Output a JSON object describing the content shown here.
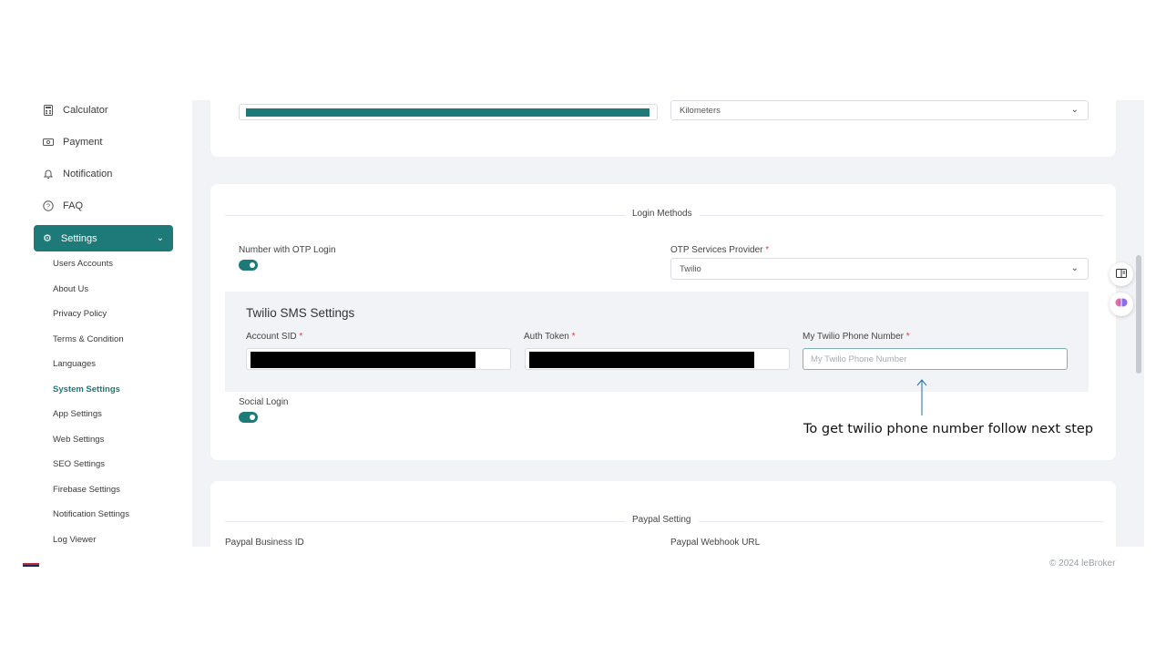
{
  "sidebar": {
    "items": [
      {
        "label": "Calculator",
        "icon": "calculator-icon"
      },
      {
        "label": "Payment",
        "icon": "payment-icon"
      },
      {
        "label": "Notification",
        "icon": "bell-icon"
      },
      {
        "label": "FAQ",
        "icon": "question-circle-icon"
      }
    ],
    "settings": {
      "label": "Settings",
      "icon": "gear-icon"
    },
    "sub_items": [
      {
        "label": "Users Accounts"
      },
      {
        "label": "About Us"
      },
      {
        "label": "Privacy Policy"
      },
      {
        "label": "Terms & Condition"
      },
      {
        "label": "Languages"
      },
      {
        "label": "System Settings",
        "active": true
      },
      {
        "label": "App Settings"
      },
      {
        "label": "Web Settings"
      },
      {
        "label": "SEO Settings"
      },
      {
        "label": "Firebase Settings"
      },
      {
        "label": "Notification Settings"
      },
      {
        "label": "Log Viewer"
      }
    ]
  },
  "top_card": {
    "unit_select": "Kilometers",
    "progress_fraction": 1.0
  },
  "login_methods": {
    "title": "Login Methods",
    "otp_label": "Number with OTP Login",
    "otp_enabled": true,
    "provider_label": "OTP Services Provider",
    "provider_value": "Twilio",
    "twilio": {
      "title": "Twilio SMS Settings",
      "account_sid_label": "Account SID",
      "auth_token_label": "Auth Token",
      "phone_label": "My Twilio Phone Number",
      "phone_placeholder": "My Twilio Phone Number"
    },
    "social_label": "Social Login",
    "social_enabled": true,
    "required_marker": "*"
  },
  "paypal": {
    "title": "Paypal Setting",
    "business_id_label": "Paypal Business ID",
    "webhook_label": "Paypal Webhook URL"
  },
  "footer": {
    "copyright": "© 2024 leBroker"
  },
  "annotation": {
    "text": "To get twilio phone number follow next step"
  },
  "colors": {
    "accent": "#1d7a78",
    "required": "#e0403b",
    "page_bg": "#f1f3f6"
  }
}
